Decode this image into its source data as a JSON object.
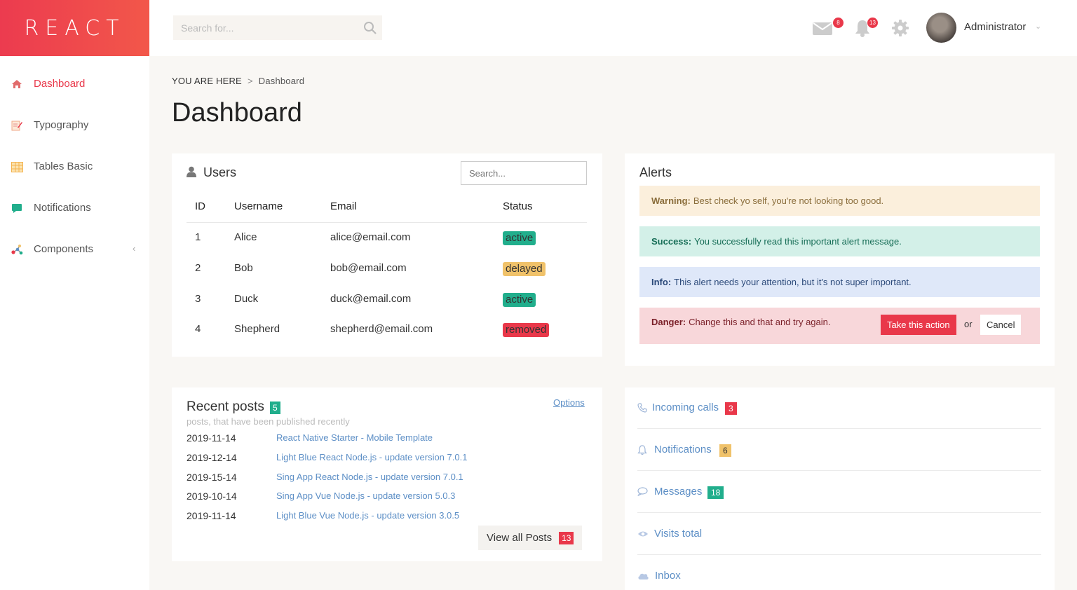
{
  "brand": {
    "logo_text": "REACT",
    "accent": "#e9384a"
  },
  "header": {
    "search_placeholder": "Search for...",
    "mail_count": "8",
    "notification_count": "13",
    "user_name": "Administrator"
  },
  "sidebar": {
    "items": [
      {
        "label": "Dashboard",
        "icon": "home-icon",
        "active": true
      },
      {
        "label": "Typography",
        "icon": "typography-icon"
      },
      {
        "label": "Tables Basic",
        "icon": "table-icon"
      },
      {
        "label": "Notifications",
        "icon": "chat-bubble-icon"
      },
      {
        "label": "Components",
        "icon": "components-icon",
        "chevron": "‹"
      }
    ]
  },
  "breadcrumb": {
    "prefix": "YOU ARE HERE",
    "separator": ">",
    "current": "Dashboard"
  },
  "page_title": "Dashboard",
  "users": {
    "title": "Users",
    "search_placeholder": "Search...",
    "columns": [
      "ID",
      "Username",
      "Email",
      "Status"
    ],
    "rows": [
      {
        "id": "1",
        "username": "Alice",
        "email": "alice@email.com",
        "status": "active",
        "status_color": "#21ae8c"
      },
      {
        "id": "2",
        "username": "Bob",
        "email": "bob@email.com",
        "status": "delayed",
        "status_color": "#f0c26a"
      },
      {
        "id": "3",
        "username": "Duck",
        "email": "duck@email.com",
        "status": "active",
        "status_color": "#21ae8c"
      },
      {
        "id": "4",
        "username": "Shepherd",
        "email": "shepherd@email.com",
        "status": "removed",
        "status_color": "#e9384a"
      }
    ]
  },
  "alerts": {
    "title": "Alerts",
    "warning": {
      "label": "Warning:",
      "text": "Best check yo self, you're not looking too good."
    },
    "success": {
      "label": "Success:",
      "text": "You successfully read this important alert message."
    },
    "info": {
      "label": "Info:",
      "text": "This alert needs your attention, but it's not super important."
    },
    "danger": {
      "label": "Danger:",
      "text": "Change this and that and try again.",
      "action_label": "Take this action",
      "or_text": "or",
      "cancel_label": "Cancel"
    }
  },
  "posts": {
    "title": "Recent posts",
    "count": "5",
    "subtitle": "posts, that have been published recently",
    "options_label": "Options",
    "items": [
      {
        "date": "2019-11-14",
        "title": "React Native Starter - Mobile Template"
      },
      {
        "date": "2019-12-14",
        "title": "Light Blue React Node.js - update version 7.0.1"
      },
      {
        "date": "2019-15-14",
        "title": "Sing App React Node.js - update version 7.0.1"
      },
      {
        "date": "2019-10-14",
        "title": "Sing App Vue Node.js - update version 5.0.3"
      },
      {
        "date": "2019-11-14",
        "title": "Light Blue Vue Node.js - update version 3.0.5"
      }
    ],
    "view_all_label": "View all Posts",
    "view_all_count": "13"
  },
  "stats": [
    {
      "label": "Incoming calls",
      "count": "3",
      "badge_color": "#e9384a",
      "icon": "phone-icon"
    },
    {
      "label": "Notifications",
      "count": "6",
      "badge_color": "#f0c26a",
      "icon": "bell-icon"
    },
    {
      "label": "Messages",
      "count": "18",
      "badge_color": "#21ae8c",
      "icon": "message-icon"
    },
    {
      "label": "Visits total",
      "count": "",
      "icon": "eye-icon"
    },
    {
      "label": "Inbox",
      "count": "",
      "icon": "cloud-icon"
    }
  ]
}
